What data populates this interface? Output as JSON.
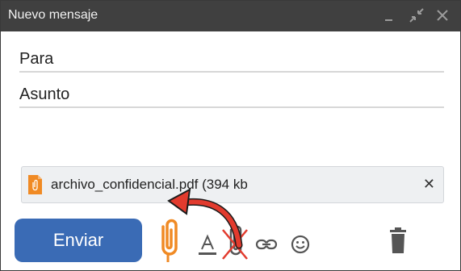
{
  "window": {
    "title": "Nuevo mensaje"
  },
  "fields": {
    "to_label": "Para",
    "subject_label": "Asunto"
  },
  "attachment": {
    "name": "archivo_confidencial.pdf (394 kb",
    "icon": "pdf-file-icon"
  },
  "toolbar": {
    "send_label": "Enviar",
    "icons": [
      "attach-icon",
      "format-text-icon",
      "attach-disabled-icon",
      "link-icon",
      "emoji-icon",
      "trash-icon"
    ]
  },
  "colors": {
    "titlebar": "#404040",
    "send_button": "#3a6bb5",
    "accent_orange": "#f08a24",
    "arrow_red": "#e23b2e"
  }
}
